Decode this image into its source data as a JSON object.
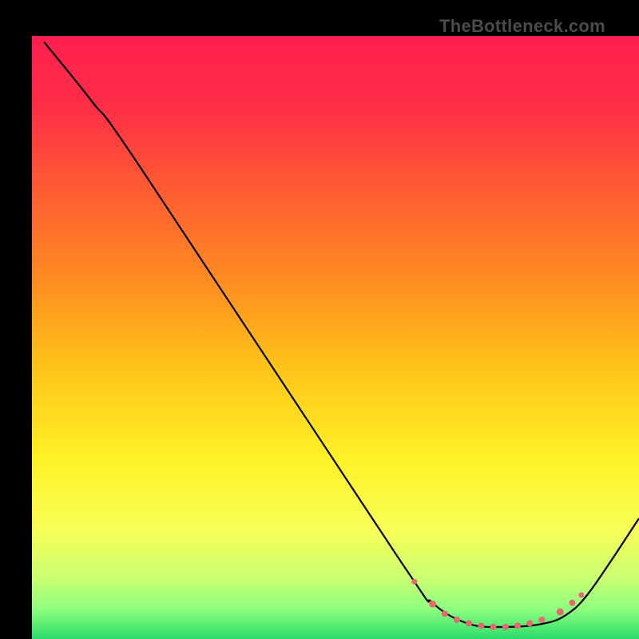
{
  "attribution": "TheBottleneck.com",
  "chart_data": {
    "type": "line",
    "title": "",
    "xlabel": "",
    "ylabel": "",
    "xlim": [
      0,
      100
    ],
    "ylim": [
      0,
      100
    ],
    "background_gradient_stops": [
      {
        "pct": 0,
        "color": "#ff1f4f"
      },
      {
        "pct": 12,
        "color": "#ff2f47"
      },
      {
        "pct": 25,
        "color": "#ff5a33"
      },
      {
        "pct": 40,
        "color": "#ff8a22"
      },
      {
        "pct": 55,
        "color": "#ffc41a"
      },
      {
        "pct": 70,
        "color": "#fff126"
      },
      {
        "pct": 82,
        "color": "#f7ff58"
      },
      {
        "pct": 90,
        "color": "#c9ff72"
      },
      {
        "pct": 95,
        "color": "#8eff7e"
      },
      {
        "pct": 100,
        "color": "#2bdc6a"
      }
    ],
    "series": [
      {
        "name": "curve",
        "points": [
          {
            "x": 2,
            "y": 99
          },
          {
            "x": 10,
            "y": 89
          },
          {
            "x": 18,
            "y": 78
          },
          {
            "x": 60,
            "y": 14
          },
          {
            "x": 66,
            "y": 6
          },
          {
            "x": 72,
            "y": 2.5
          },
          {
            "x": 78,
            "y": 2
          },
          {
            "x": 84,
            "y": 2.5
          },
          {
            "x": 88,
            "y": 4
          },
          {
            "x": 92,
            "y": 8
          },
          {
            "x": 100,
            "y": 20
          }
        ]
      }
    ],
    "markers": [
      {
        "x": 63,
        "y": 9.5,
        "r": 3.5
      },
      {
        "x": 66,
        "y": 5.8,
        "r": 4.5
      },
      {
        "x": 68,
        "y": 4.2,
        "r": 4.0
      },
      {
        "x": 70,
        "y": 3.2,
        "r": 4.0
      },
      {
        "x": 72,
        "y": 2.6,
        "r": 4.0
      },
      {
        "x": 74,
        "y": 2.2,
        "r": 4.0
      },
      {
        "x": 76,
        "y": 2.0,
        "r": 4.0
      },
      {
        "x": 78,
        "y": 2.0,
        "r": 4.0
      },
      {
        "x": 80,
        "y": 2.2,
        "r": 4.0
      },
      {
        "x": 82,
        "y": 2.6,
        "r": 4.0
      },
      {
        "x": 84,
        "y": 3.2,
        "r": 4.0
      },
      {
        "x": 87,
        "y": 4.5,
        "r": 4.5
      },
      {
        "x": 89,
        "y": 6.0,
        "r": 4.0
      },
      {
        "x": 90.5,
        "y": 7.3,
        "r": 3.5
      }
    ],
    "marker_color": "#e46a6f",
    "curve_color": "#000000",
    "curve_width": 2.2
  }
}
